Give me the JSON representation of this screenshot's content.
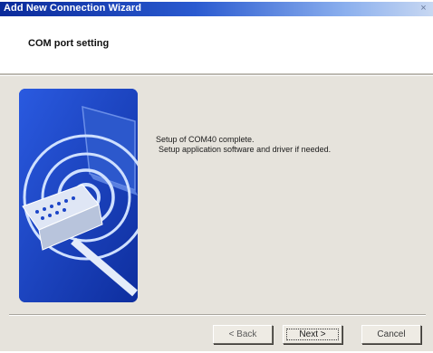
{
  "window": {
    "title": "Add New Connection Wizard",
    "close_glyph": "×"
  },
  "header": {
    "title": "COM port setting"
  },
  "art": {
    "icon": "serial-port-wireless-icon",
    "colors": {
      "background": "#1c45c8",
      "rings": "#cfe0ff"
    }
  },
  "message": {
    "line1": "Setup of COM40 complete.",
    "line2": "Setup application software and driver if needed."
  },
  "buttons": {
    "back": "< Back",
    "next": "Next >",
    "cancel": "Cancel"
  }
}
